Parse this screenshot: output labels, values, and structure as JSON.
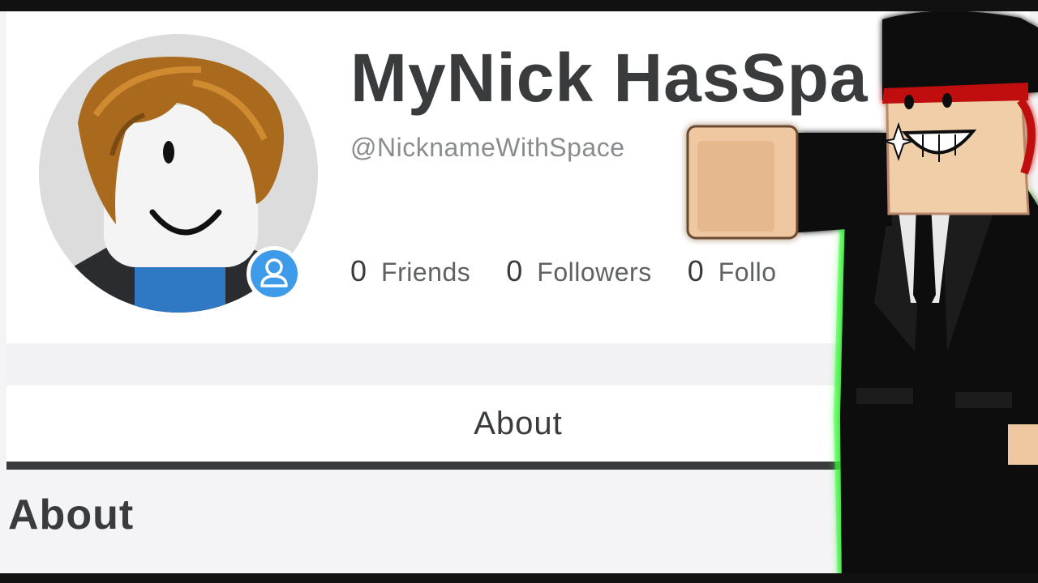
{
  "profile": {
    "display_name": "MyNick HasSpa",
    "username": "@NicknameWithSpace",
    "avatar_icon": "avatar-headshot",
    "presence_icon": "user-icon"
  },
  "stats": [
    {
      "count": "0",
      "label": "Friends"
    },
    {
      "count": "0",
      "label": "Followers"
    },
    {
      "count": "0",
      "label": "Follo"
    }
  ],
  "tabs": {
    "about": "About"
  },
  "sections": {
    "about_title": "About"
  },
  "colors": {
    "accent_blue": "#3d9be9",
    "text_dark": "#393b3d",
    "text_muted": "#8a8c8e",
    "card_bg": "#ffffff",
    "page_bg": "#f4f4f6",
    "glow_green": "#3cff3c"
  }
}
